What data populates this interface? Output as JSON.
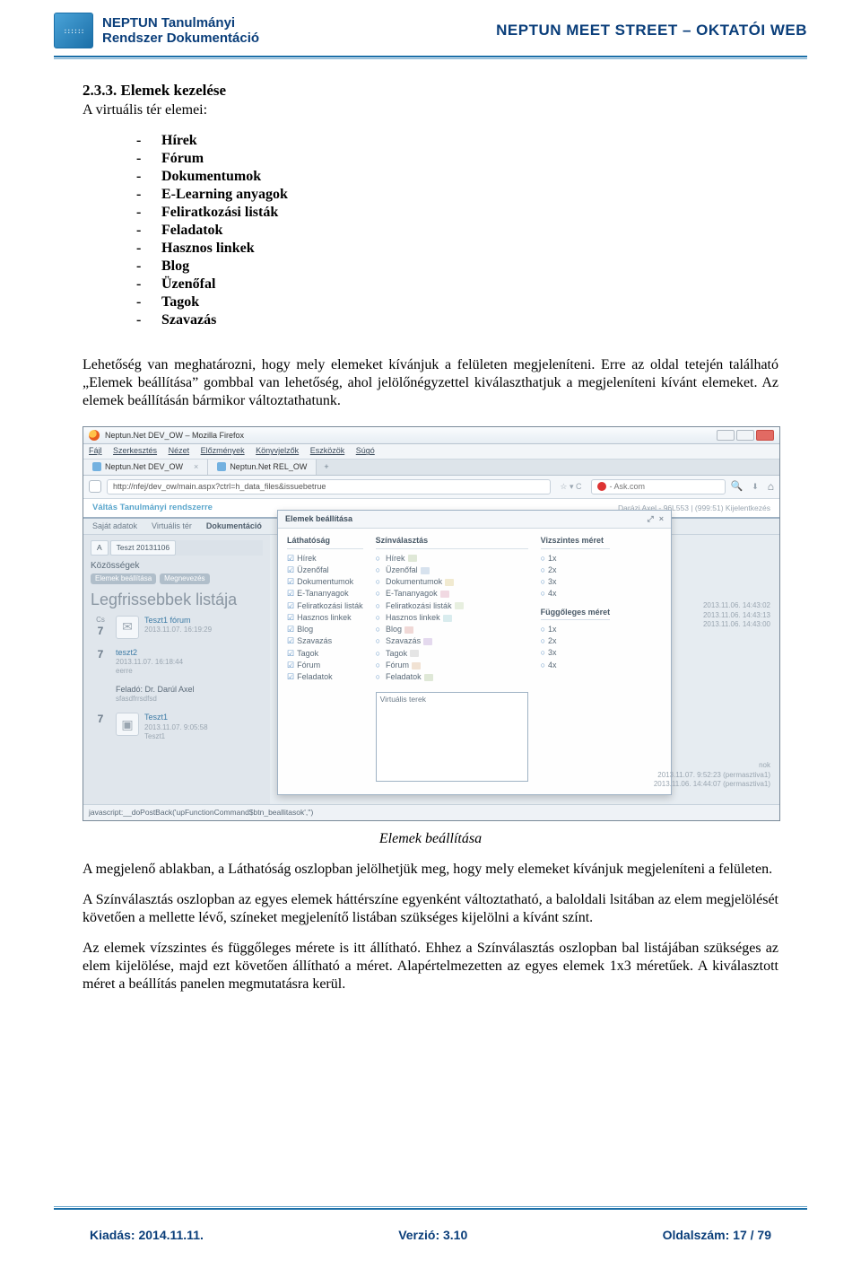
{
  "header": {
    "logo_text": "::::::",
    "left_line1": "NEPTUN Tanulmányi",
    "left_line2": "Rendszer Dokumentáció",
    "right": "NEPTUN MEET STREET – OKTATÓI WEB"
  },
  "body": {
    "heading": "2.3.3. Elemek kezelése",
    "intro": "A virtuális tér elemei:",
    "elem_list": [
      "Hírek",
      "Fórum",
      "Dokumentumok",
      "E-Learning anyagok",
      "Feliratkozási listák",
      "Feladatok",
      "Hasznos linkek",
      "Blog",
      "Üzenőfal",
      "Tagok",
      "Szavazás"
    ],
    "para1": "Lehetőség van meghatározni, hogy mely elemeket kívánjuk a felületen megjeleníteni. Erre az oldal tetején található „Elemek beállítása” gombbal van lehetőség, ahol jelölőnégyzettel kiválaszthatjuk a megjeleníteni kívánt elemeket. Az elemek beállításán bármikor változtathatunk.",
    "caption": "Elemek beállítása",
    "para2": "A megjelenő ablakban, a Láthatóság oszlopban jelölhetjük meg, hogy mely elemeket kívánjuk megjeleníteni a felületen.",
    "para3": "A Színválasztás oszlopban az egyes elemek háttérszíne egyenként változtatható, a baloldali lsitában az elem megjelölését követően a mellette lévő, színeket megjelenítő listában szükséges kijelölni a kívánt színt.",
    "para4": "Az elemek vízszintes és függőleges mérete is itt állítható. Ehhez a Színválasztás oszlopban bal listájában szükséges az elem kijelölése, majd ezt követően állítható a méret. Alapértelmezetten az egyes elemek 1x3 méretűek. A kiválasztott méret a beállítás panelen megmutatásra kerül."
  },
  "screenshot": {
    "window_title": "Neptun.Net DEV_OW – Mozilla Firefox",
    "menu": [
      "Fájl",
      "Szerkesztés",
      "Nézet",
      "Előzmények",
      "Könyvjelzők",
      "Eszközök",
      "Súgó"
    ],
    "tabs": [
      "Neptun.Net DEV_OW",
      "Neptun.Net REL_OW"
    ],
    "tab_plus": "+",
    "url": "http://nfej/dev_ow/main.aspx?ctrl=h_data_files&issuebetrue",
    "search_engine": "- Ask.com",
    "top_switch": "Váltás Tanulmányi rendszerre",
    "top_right": "Darázi Axel - 96L553 | (999:51) Kijelentkezés",
    "sub_tabs": [
      "Saját adatok",
      "Virtuális tér",
      "Dokumentáció"
    ],
    "vt_tabs": [
      "A",
      "Teszt 20131106"
    ],
    "pgrey": "Közösségek",
    "pills": [
      "Elemek beállítása",
      "Megnevezés"
    ],
    "legfriss": "Legfrissebbek listája",
    "feed": [
      {
        "day": "7",
        "mon": "Cs",
        "icon": "✉",
        "title": "Teszt1 fórum",
        "line": "2013.11.07. 16:19:29"
      },
      {
        "day": "7",
        "mon": "",
        "icon": "",
        "title": "teszt2",
        "line": "2013.11.07. 16:18:44",
        "sub": "eerre"
      },
      {
        "day": "",
        "mon": "",
        "icon": "",
        "title": "Feladó: Dr. Darúl Axel",
        "line": "sfasdfrrsdfsd"
      },
      {
        "day": "7",
        "mon": "",
        "icon": "▣",
        "title": "Teszt1",
        "line": "2013.11.07. 9:05:58",
        "sub": "Teszt1"
      }
    ],
    "right_times_1": [
      "2013.11.06. 14:43:02",
      "2013.11.06. 14:43:13",
      "2013.11.06. 14:43:00"
    ],
    "right_times_2": [
      "2013.11.07. 9:52:23 (permasztiva1)",
      "2013.11.06. 14:44:07 (permasztiva1)"
    ],
    "right_links_label": "nok",
    "modal": {
      "title": "Elemek beállítása",
      "col_vis": {
        "h": "Láthatóság",
        "items": [
          "Hírek",
          "Üzenőfal",
          "Dokumentumok",
          "E-Tananyagok",
          "Feliratkozási listák",
          "Hasznos linkek",
          "Blog",
          "Szavazás",
          "Tagok",
          "Fórum",
          "Feladatok"
        ]
      },
      "col_color": {
        "h": "Színválasztás",
        "items": [
          "Hírek",
          "Üzenőfal",
          "Dokumentumok",
          "E-Tananyagok",
          "Feliratkozási listák",
          "Hasznos linkek",
          "Blog",
          "Szavazás",
          "Tagok",
          "Fórum",
          "Feladatok"
        ]
      },
      "col_hsize": {
        "h": "Vizszintes méret",
        "items": [
          "1x",
          "2x",
          "3x",
          "4x"
        ]
      },
      "col_vsize": {
        "h": "Függőleges méret",
        "items": [
          "1x",
          "2x",
          "3x",
          "4x"
        ]
      },
      "preview_label": "Virtuális terek"
    },
    "status": "javascript:__doPostBack('upFunctionCommand$btn_beallitasok','')"
  },
  "footer": {
    "left": "Kiadás: 2014.11.11.",
    "center": "Verzió: 3.10",
    "right": "Oldalszám: 17 / 79"
  }
}
